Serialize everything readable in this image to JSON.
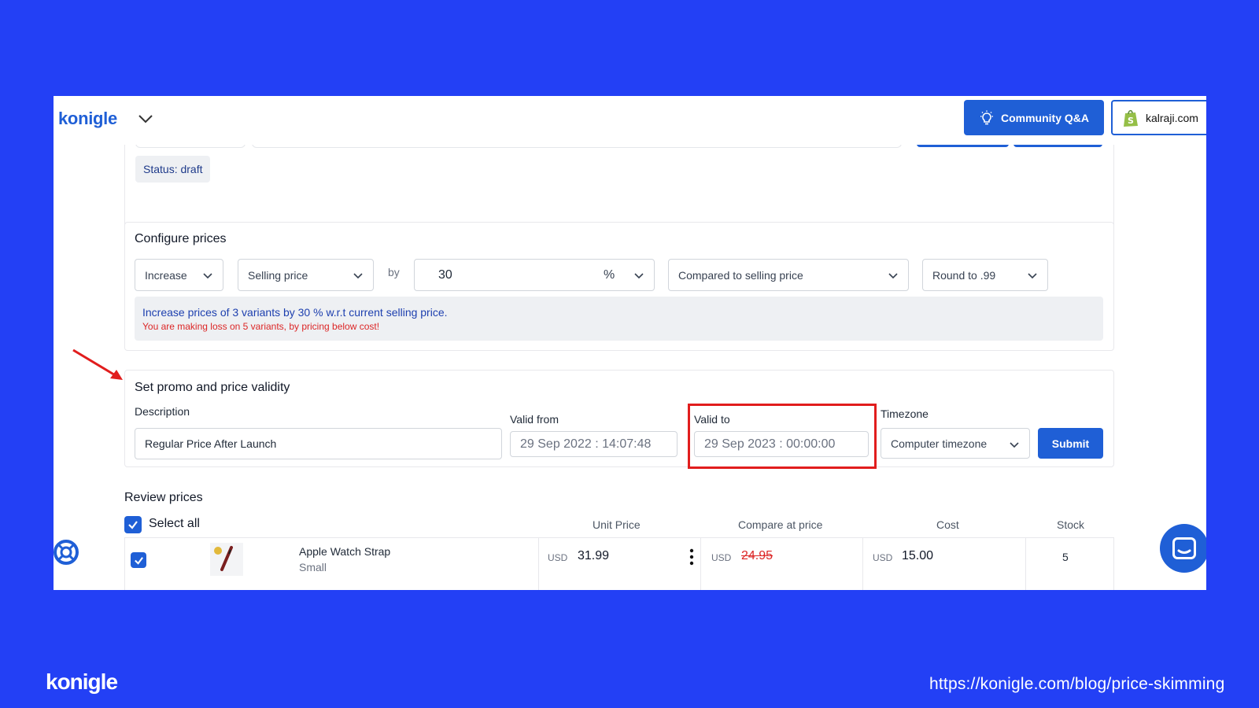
{
  "header": {
    "app_name": "konigle",
    "community_label": "Community Q&A",
    "store_label": "kalraji.com"
  },
  "status": {
    "text": "Status: draft"
  },
  "configure": {
    "title": "Configure prices",
    "action": "Increase",
    "basis": "Selling price",
    "by_label": "by",
    "amount": "30",
    "unit": "%",
    "compare": "Compared to selling price",
    "rounding": "Round to .99",
    "info": "Increase prices of 3 variants by 30 % w.r.t current selling price.",
    "warning": "You are making loss on 5 variants, by pricing below cost!"
  },
  "promo": {
    "title": "Set promo and price validity",
    "description_label": "Description",
    "description_value": "Regular Price After Launch",
    "valid_from_label": "Valid from",
    "valid_from_value": "29 Sep 2022 : 14:07:48",
    "valid_to_label": "Valid to",
    "valid_to_value": "29 Sep 2023 : 00:00:00",
    "timezone_label": "Timezone",
    "timezone_value": "Computer timezone",
    "submit_label": "Submit"
  },
  "review": {
    "title": "Review prices",
    "select_all_label": "Select all",
    "columns": [
      "Unit Price",
      "Compare at price",
      "Cost",
      "Stock"
    ],
    "rows": [
      {
        "name": "Apple Watch Strap",
        "variant": "Small",
        "currency": "USD",
        "unit_price": "31.99",
        "compare_at_price": "24.95",
        "cost": "15.00",
        "stock": "5",
        "checked": true
      }
    ]
  },
  "footer": {
    "brand": "konigle",
    "url": "https://konigle.com/blog/price-skimming"
  },
  "colors": {
    "background": "#2340f5",
    "accent": "#1f5fd6",
    "warning": "#dc2626",
    "highlight": "#e11d1d"
  }
}
